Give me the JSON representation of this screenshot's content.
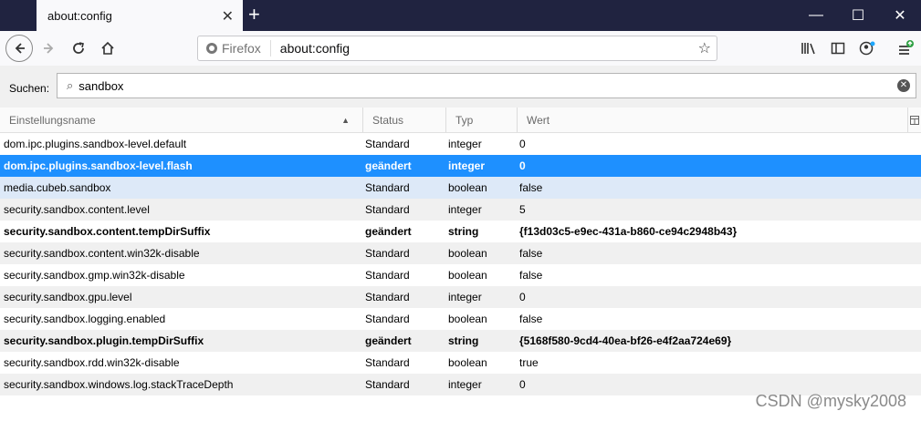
{
  "window": {
    "tab_title": "about:config",
    "tab_close": "✕",
    "new_tab": "+",
    "minimize": "—",
    "maximize": "☐",
    "close": "✕"
  },
  "navbar": {
    "identity": "Firefox",
    "url": "about:config"
  },
  "search": {
    "label": "Suchen:",
    "value": "sandbox"
  },
  "columns": [
    "Einstellungsname",
    "Status",
    "Typ",
    "Wert"
  ],
  "rows": [
    {
      "name": "dom.ipc.plugins.sandbox-level.default",
      "status": "Standard",
      "type": "integer",
      "value": "0"
    },
    {
      "name": "dom.ipc.plugins.sandbox-level.flash",
      "status": "geändert",
      "type": "integer",
      "value": "0"
    },
    {
      "name": "media.cubeb.sandbox",
      "status": "Standard",
      "type": "boolean",
      "value": "false"
    },
    {
      "name": "security.sandbox.content.level",
      "status": "Standard",
      "type": "integer",
      "value": "5"
    },
    {
      "name": "security.sandbox.content.tempDirSuffix",
      "status": "geändert",
      "type": "string",
      "value": "{f13d03c5-e9ec-431a-b860-ce94c2948b43}"
    },
    {
      "name": "security.sandbox.content.win32k-disable",
      "status": "Standard",
      "type": "boolean",
      "value": "false"
    },
    {
      "name": "security.sandbox.gmp.win32k-disable",
      "status": "Standard",
      "type": "boolean",
      "value": "false"
    },
    {
      "name": "security.sandbox.gpu.level",
      "status": "Standard",
      "type": "integer",
      "value": "0"
    },
    {
      "name": "security.sandbox.logging.enabled",
      "status": "Standard",
      "type": "boolean",
      "value": "false"
    },
    {
      "name": "security.sandbox.plugin.tempDirSuffix",
      "status": "geändert",
      "type": "string",
      "value": "{5168f580-9cd4-40ea-bf26-e4f2aa724e69}"
    },
    {
      "name": "security.sandbox.rdd.win32k-disable",
      "status": "Standard",
      "type": "boolean",
      "value": "true"
    },
    {
      "name": "security.sandbox.windows.log.stackTraceDepth",
      "status": "Standard",
      "type": "integer",
      "value": "0"
    }
  ],
  "watermark": "CSDN @mysky2008"
}
